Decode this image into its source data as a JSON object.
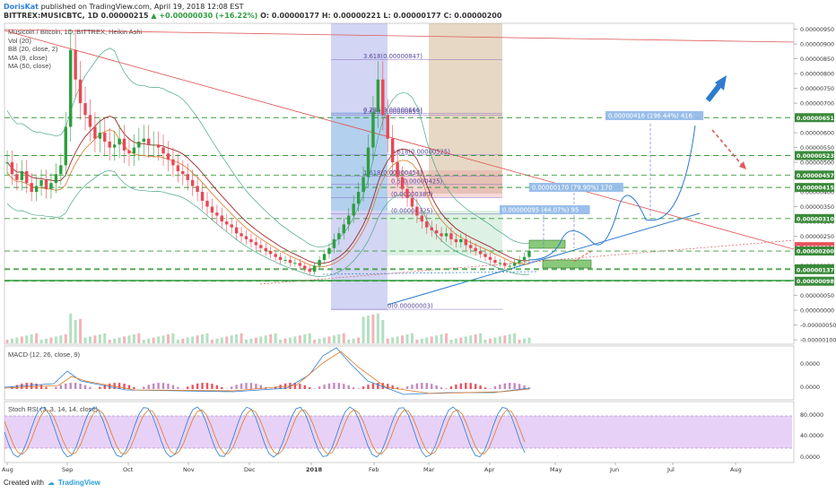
{
  "header": {
    "author": "DorisKat",
    "published": "published on TradingView.com, April 19, 2018 12:08 EST",
    "symbol": "BITTREX:MUSICBTC, 1D",
    "open": "0.00000215",
    "change": "▲ +0.00000030 (+16.22%)",
    "ohlc": "O: 0.00000177 H: 0.00000221 L: 0.00000177 C: 0.00000200"
  },
  "legend": {
    "title": "Musicoin / Bitcoin, 1D, BITTREX, Heikin Ashi",
    "lines": [
      "Vol (20)",
      "BB (20, close, 2)",
      "MA (9, close)",
      "MA (50, close)"
    ]
  },
  "macd_label": "MACD (12, 26, close, 9)",
  "stoch_label": "Stoch RSI (3, 3, 14, 14, close)",
  "footer": {
    "created": "Created with",
    "brand": "TradingView"
  },
  "colors": {
    "up": "#e84855",
    "down": "#2e9e3e",
    "bb": "#4aa58a",
    "ma9": "#9b2a2a",
    "ma50": "#d97a2b",
    "projection": "#2e7bd1",
    "level": "#2e9e3e"
  },
  "chart_data": {
    "type": "candlestick",
    "xaxis_ticks": [
      "Aug",
      "Sep",
      "Oct",
      "Nov",
      "Dec",
      "2018",
      "Feb",
      "Mar",
      "Apr",
      "May",
      "Jun",
      "Jul",
      "Aug"
    ],
    "yaxis_ticks": [
      "0.00000950",
      "0.00000900",
      "0.00000850",
      "0.00000800",
      "0.00000750",
      "0.00000700",
      "0.00000650",
      "0.00000600",
      "0.00000550",
      "0.00000500",
      "0.00000450",
      "0.00000400",
      "0.00000350",
      "0.00000300",
      "0.00000250",
      "0.00000200",
      "0.00000150",
      "0.00000100",
      "0.00000050",
      "0.00000000",
      "-0.00000050",
      "-0.00000100"
    ],
    "ylim": [
      -1.15e-06,
      9.7e-06
    ],
    "price_labels": [
      {
        "value": 6.51e-06,
        "text": "0.00000651"
      },
      {
        "value": 5.23e-06,
        "text": "0.00000523"
      },
      {
        "value": 4.57e-06,
        "text": "0.00000457"
      },
      {
        "value": 4.15e-06,
        "text": "0.00000415"
      },
      {
        "value": 3.1e-06,
        "text": "0.00000310"
      },
      {
        "value": 2.15e-06,
        "text": "0.00000215"
      },
      {
        "value": 2.12e-06,
        "text": "0.00000212"
      },
      {
        "value": 2e-06,
        "text": "0.00000200"
      },
      {
        "value": 1.4e-06,
        "text": "0.00000140"
      },
      {
        "value": 1.37e-06,
        "text": "0.00000137"
      },
      {
        "value": 9.8e-07,
        "text": "0.00000098"
      }
    ],
    "fib_labels": [
      {
        "value": 8.47e-06,
        "text": "3.618(0.00000847)"
      },
      {
        "value": 6.66e-06,
        "text": "0.786(0.00000666)"
      },
      {
        "value": 6.59e-06,
        "text": "2.618(0.00000659)"
      },
      {
        "value": 5.25e-06,
        "text": "0.618(0.00000525)"
      },
      {
        "value": 4.54e-06,
        "text": "1.618(0.00000454)"
      },
      {
        "value": 4.25e-06,
        "text": "0.5(0.00000425)"
      },
      {
        "value": 3.8e-06,
        "text": "(0.00000380)"
      },
      {
        "value": 3.25e-06,
        "text": "(0.00000325)"
      },
      {
        "value": 3e-08,
        "text": "0(0.00000003)"
      }
    ],
    "targets": [
      {
        "price": 3.1e-06,
        "text": "0.00000095 (44.07%) 95"
      },
      {
        "price": 4.15e-06,
        "text": "0.00000170 (79.90%) 170"
      },
      {
        "price": 6.51e-06,
        "text": "0.00000416 (196.44%) 416"
      }
    ],
    "heikin_ashi_close": [
      5e-06,
      4.6e-06,
      4.4e-06,
      4.7e-06,
      4.3e-06,
      4e-06,
      4.2e-06,
      4.4e-06,
      4.1e-06,
      4.3e-06,
      4.6e-06,
      4.9e-06,
      6.2e-06,
      8.8e-06,
      7.8e-06,
      7e-06,
      6.6e-06,
      6.2e-06,
      5.8e-06,
      6e-06,
      5.7e-06,
      5.5e-06,
      5.6e-06,
      5.8e-06,
      5.4e-06,
      5.3e-06,
      5.5e-06,
      5.7e-06,
      5.8e-06,
      5.6e-06,
      5.6e-06,
      5.5e-06,
      5.3e-06,
      5.1e-06,
      4.9e-06,
      4.7e-06,
      4.6e-06,
      4.4e-06,
      4.2e-06,
      4e-06,
      3.7e-06,
      3.5e-06,
      3.3e-06,
      3.2e-06,
      3e-06,
      2.9e-06,
      2.8e-06,
      2.6e-06,
      2.5e-06,
      2.4e-06,
      2.3e-06,
      2.2e-06,
      2.1e-06,
      2e-06,
      1.9e-06,
      1.8e-06,
      1.7e-06,
      1.7e-06,
      1.6e-06,
      1.6e-06,
      1.5e-06,
      1.4e-06,
      1.3e-06,
      1.5e-06,
      1.7e-06,
      1.9e-06,
      2.1e-06,
      2.4e-06,
      2.6e-06,
      2.9e-06,
      3.2e-06,
      3.6e-06,
      4e-06,
      4.5e-06,
      5.5e-06,
      6.7e-06,
      7.8e-06,
      6.6e-06,
      5.8e-06,
      5e-06,
      4.5e-06,
      4.1e-06,
      3.8e-06,
      3.5e-06,
      3.2e-06,
      3e-06,
      2.8e-06,
      2.7e-06,
      2.6e-06,
      2.5e-06,
      2.6e-06,
      2.4e-06,
      2.3e-06,
      2.4e-06,
      2.2e-06,
      2.1e-06,
      2e-06,
      1.9e-06,
      1.8e-06,
      1.7e-06,
      1.6e-06,
      1.6e-06,
      1.5e-06,
      1.5e-06,
      1.6e-06,
      1.7e-06,
      1.8e-06,
      2e-06
    ],
    "macd_ticks": [
      "0.0000",
      "0.0000"
    ],
    "stoch_ticks": [
      "80.0000",
      "40.0000",
      "0.0000"
    ]
  }
}
